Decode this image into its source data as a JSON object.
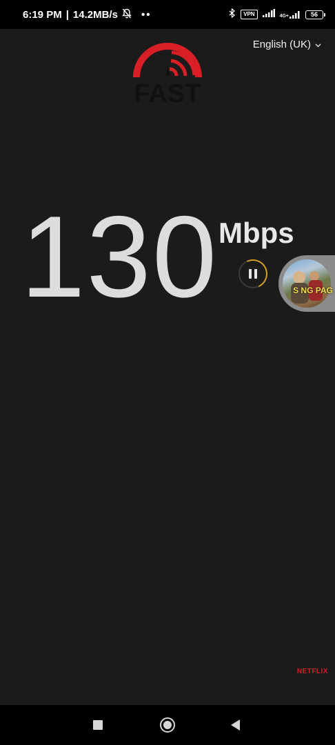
{
  "status_bar": {
    "time": "6:19 PM",
    "separator": "|",
    "net_speed": "14.2MB/s",
    "more": "••",
    "vpn_label": "VPN",
    "mobile_type": "4G+",
    "battery_level": "56"
  },
  "app": {
    "language": "English (UK)",
    "logo_text": "FAST",
    "speed_value": "130",
    "speed_units": "Mbps",
    "netflix_label": "NETFLIX"
  },
  "bubble": {
    "caption": "S NG PAG"
  },
  "colors": {
    "accent_red": "#d81f26",
    "progress_gold": "#d9a021",
    "background": "#1b1b1b"
  },
  "icons": [
    "bell-off-icon",
    "bluetooth-icon",
    "signal-icon",
    "battery-icon",
    "pause-icon",
    "chevron-down-icon",
    "recent-apps-icon",
    "home-icon",
    "back-icon"
  ]
}
